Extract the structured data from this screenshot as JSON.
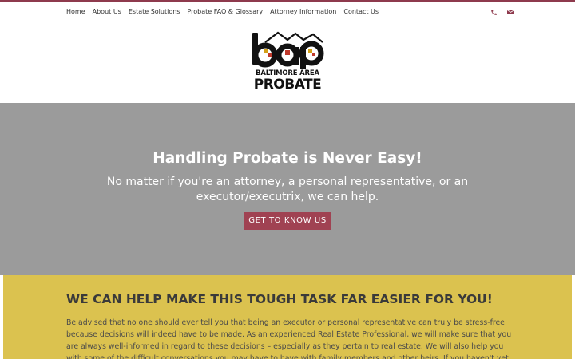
{
  "theme": {
    "accent": "#8e3a4d",
    "button": "#a04252",
    "hero_bg": "#9b9b9b",
    "section_bg": "#dbc24f"
  },
  "nav": {
    "links": [
      "Home",
      "About Us",
      "Estate Solutions",
      "Probate FAQ & Glossary",
      "Attorney Information",
      "Contact Us"
    ],
    "icons": [
      "phone-icon",
      "envelope-icon"
    ]
  },
  "logo": {
    "line1": "BALTIMORE AREA",
    "line2": "PROBATE"
  },
  "hero": {
    "title": "Handling Probate is Never Easy!",
    "subtitle": "No matter if you're an attorney, a personal representative, or an executor/executrix, we can help.",
    "button": "GET TO KNOW US"
  },
  "section": {
    "title": "WE CAN HELP MAKE THIS TOUGH TASK FAR EASIER FOR YOU!",
    "body": "Be advised that no one should ever tell you that being an executor or personal representative can truly be stress-free because decisions will indeed have to be made. As an experienced Real Estate Professional, we will make sure that you are always well-informed in regard to these decisions – especially as they pertain to real estate. We will also help you with some of the difficult conversations you may have to have with family members and other heirs. If you haven't yet secured"
  }
}
